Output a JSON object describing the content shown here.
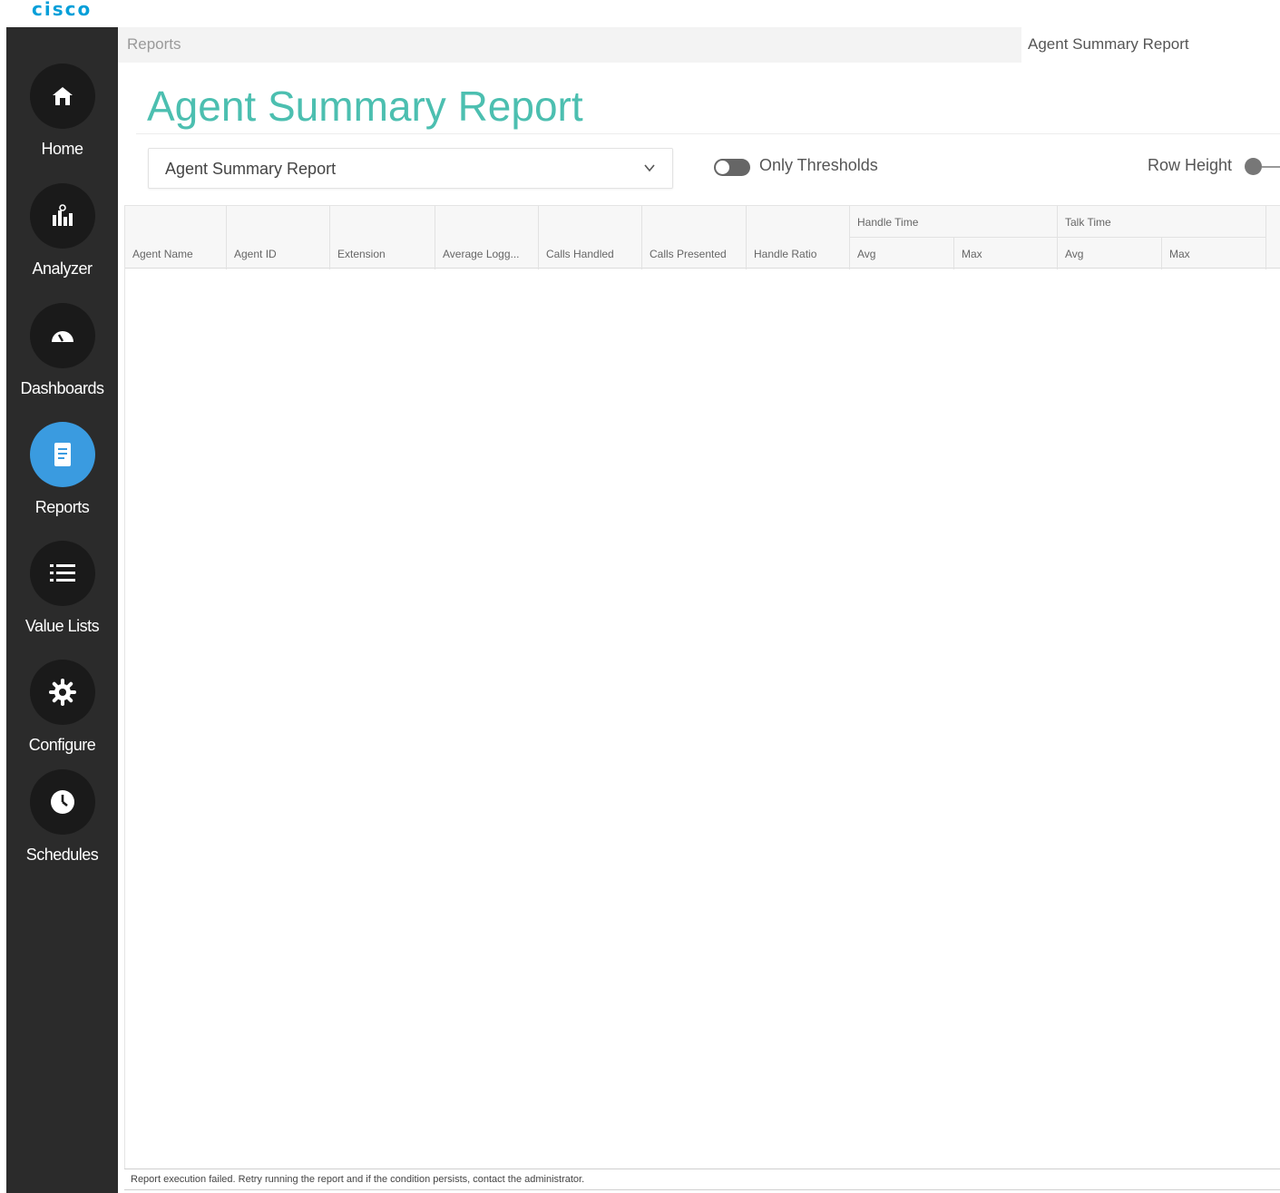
{
  "brand": {
    "logo_text": "cisco"
  },
  "sidebar": {
    "items": [
      {
        "label": "Home",
        "icon": "home-icon",
        "active": false
      },
      {
        "label": "Analyzer",
        "icon": "analyzer-icon",
        "active": false
      },
      {
        "label": "Dashboards",
        "icon": "gauge-icon",
        "active": false
      },
      {
        "label": "Reports",
        "icon": "document-icon",
        "active": true
      },
      {
        "label": "Value Lists",
        "icon": "list-icon",
        "active": false
      },
      {
        "label": "Configure",
        "icon": "gear-icon",
        "active": false
      },
      {
        "label": "Schedules",
        "icon": "clock-icon",
        "active": false
      }
    ],
    "active_color": "#3a9be0"
  },
  "breadcrumb": {
    "root": "Reports",
    "tab": "Agent Summary Report"
  },
  "page": {
    "title": "Agent Summary Report",
    "title_color": "#4cbfb0"
  },
  "controls": {
    "report_select": "Agent Summary Report",
    "only_thresholds_label": "Only Thresholds",
    "only_thresholds_on": false,
    "row_height_label": "Row Height"
  },
  "grid": {
    "columns": [
      "Agent Name",
      "Agent ID",
      "Extension",
      "Average Logg...",
      "Calls Handled",
      "Calls Presented",
      "Handle Ratio"
    ],
    "groups": [
      {
        "label": "Handle Time",
        "sub": [
          "Avg",
          "Max"
        ]
      },
      {
        "label": "Talk Time",
        "sub": [
          "Avg",
          "Max"
        ]
      }
    ],
    "rows": []
  },
  "status": {
    "message": "Report execution failed. Retry running the report and if the condition persists, contact the administrator."
  }
}
